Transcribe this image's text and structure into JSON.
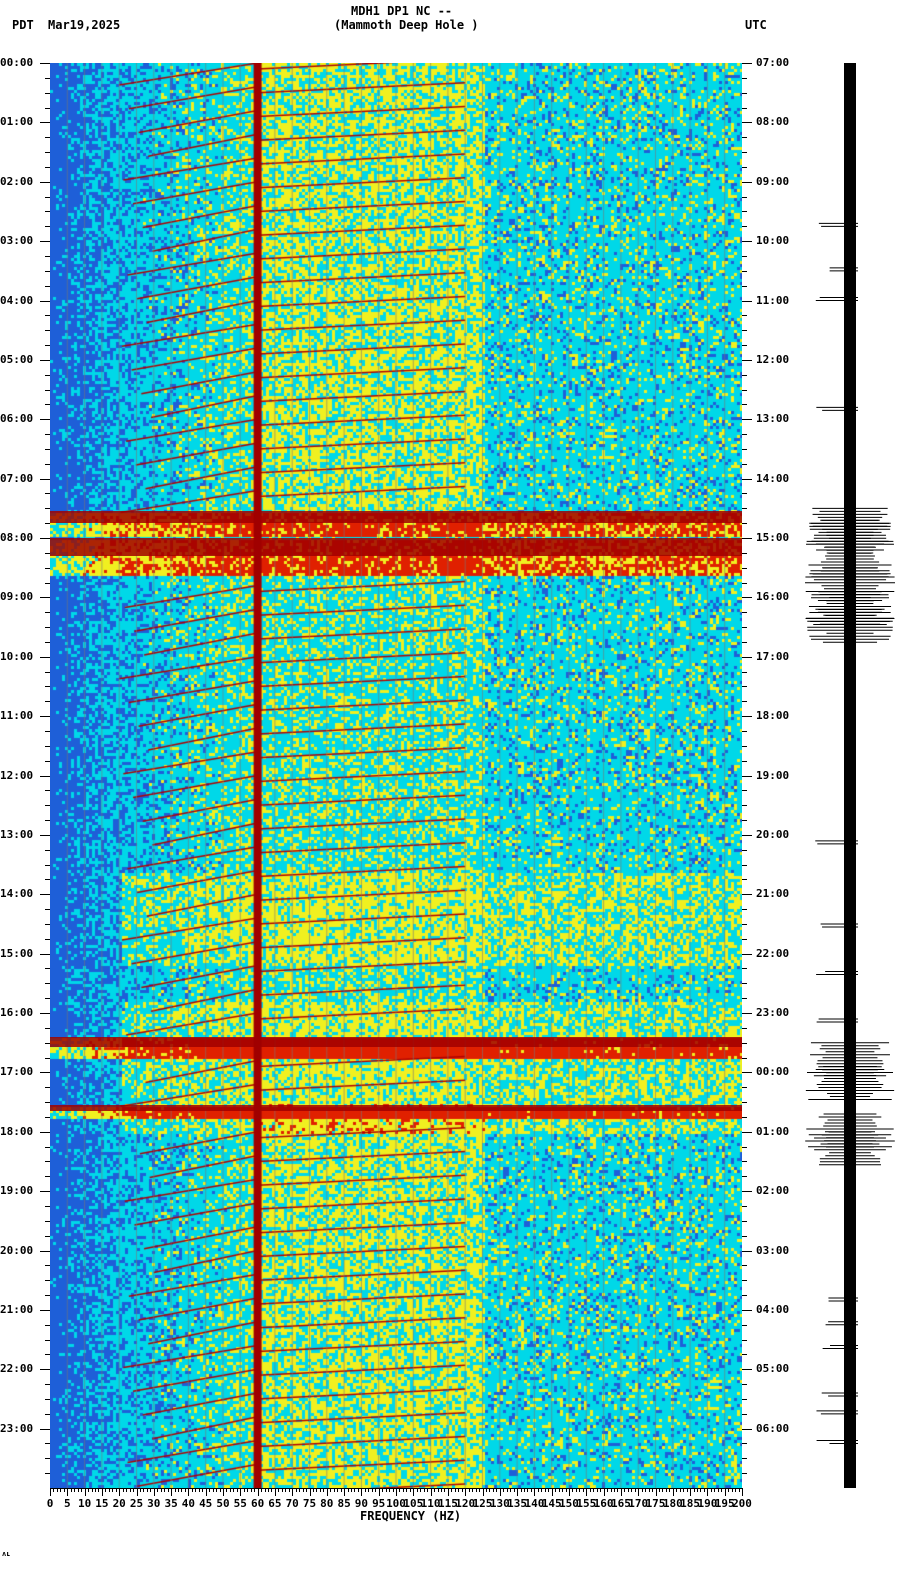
{
  "header": {
    "title": "MDH1 DP1 NC --",
    "subtitle": "(Mammoth Deep Hole )",
    "left_tz": "PDT",
    "date": "Mar19,2025",
    "right_tz": "UTC"
  },
  "footer_mark": "ʌʟ",
  "chart_data": {
    "type": "heatmap",
    "title": "MDH1 DP1 NC --",
    "xlabel": "FREQUENCY (HZ)",
    "xlim": [
      0,
      200
    ],
    "x_ticks": [
      "0",
      "5",
      "10",
      "15",
      "20",
      "25",
      "30",
      "35",
      "40",
      "45",
      "50",
      "55",
      "60",
      "65",
      "70",
      "75",
      "80",
      "85",
      "90",
      "95",
      "100",
      "105",
      "110",
      "115",
      "120",
      "125",
      "130",
      "135",
      "140",
      "145",
      "150",
      "155",
      "160",
      "165",
      "170",
      "175",
      "180",
      "185",
      "190",
      "195",
      "200"
    ],
    "ylim_hours": [
      0,
      24
    ],
    "y_ticks_left": [
      "00:00",
      "01:00",
      "02:00",
      "03:00",
      "04:00",
      "05:00",
      "06:00",
      "07:00",
      "08:00",
      "09:00",
      "10:00",
      "11:00",
      "12:00",
      "13:00",
      "14:00",
      "15:00",
      "16:00",
      "17:00",
      "18:00",
      "19:00",
      "20:00",
      "21:00",
      "22:00",
      "23:00"
    ],
    "y_ticks_right": [
      "07:00",
      "08:00",
      "09:00",
      "10:00",
      "11:00",
      "12:00",
      "13:00",
      "14:00",
      "15:00",
      "16:00",
      "17:00",
      "18:00",
      "19:00",
      "20:00",
      "21:00",
      "22:00",
      "23:00",
      "00:00",
      "01:00",
      "02:00",
      "03:00",
      "04:00",
      "05:00",
      "06:00"
    ],
    "colormap": [
      "#1e5fd8",
      "#00d8e8",
      "#f0f020",
      "#e02000",
      "#a00000"
    ],
    "persistent_lines_hz": [
      60
    ],
    "high_energy_bands_hours": [
      [
        7.55,
        7.95
      ],
      [
        8.0,
        8.6
      ],
      [
        16.4,
        16.75
      ],
      [
        17.55,
        17.75
      ]
    ],
    "seismogram_events_hours": [
      2.7,
      3.45,
      3.95,
      5.8,
      7.5,
      7.7,
      8.1,
      8.5,
      8.9,
      9.2,
      13.1,
      14.5,
      15.3,
      16.1,
      16.5,
      16.9,
      17.7,
      18.0,
      20.8,
      21.2,
      21.6,
      22.4,
      22.7,
      23.2
    ]
  }
}
